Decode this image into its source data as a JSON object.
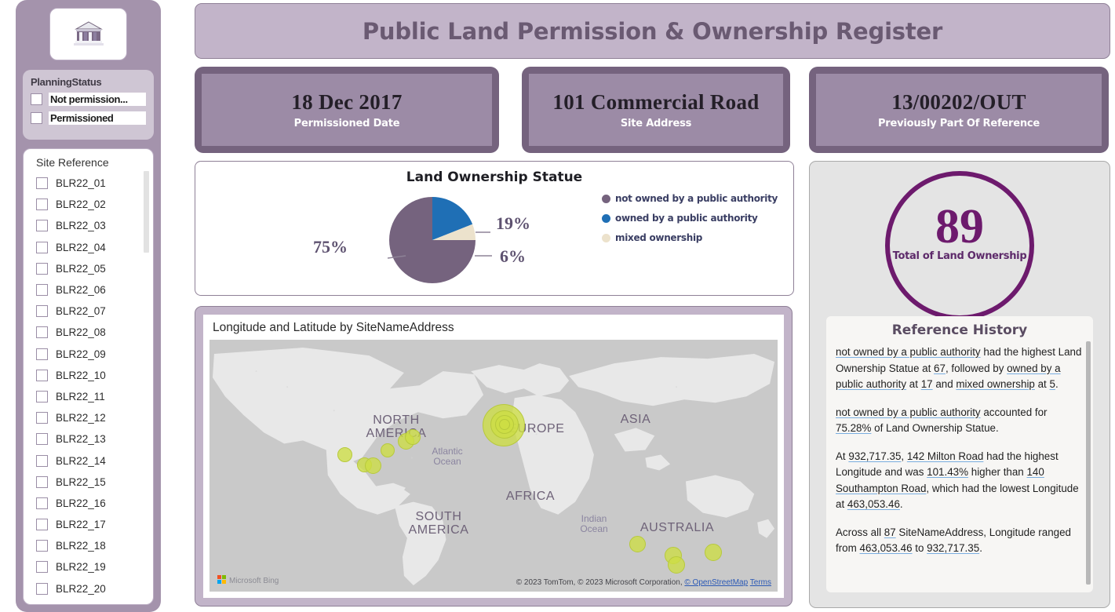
{
  "header": {
    "title": "Public Land Permission & Ownership Register"
  },
  "sidebar": {
    "brand_icon": "bank-building-icon",
    "status_filter": {
      "title": "PlanningStatus",
      "options": [
        {
          "label": "Not permission...",
          "checked": false
        },
        {
          "label": "Permissioned",
          "checked": false
        }
      ]
    },
    "site_reference": {
      "title": "Site Reference",
      "items": [
        {
          "label": "BLR22_01",
          "checked": false
        },
        {
          "label": "BLR22_02",
          "checked": false
        },
        {
          "label": "BLR22_03",
          "checked": false
        },
        {
          "label": "BLR22_04",
          "checked": false
        },
        {
          "label": "BLR22_05",
          "checked": false
        },
        {
          "label": "BLR22_06",
          "checked": false
        },
        {
          "label": "BLR22_07",
          "checked": false
        },
        {
          "label": "BLR22_08",
          "checked": false
        },
        {
          "label": "BLR22_09",
          "checked": false
        },
        {
          "label": "BLR22_10",
          "checked": false
        },
        {
          "label": "BLR22_11",
          "checked": false
        },
        {
          "label": "BLR22_12",
          "checked": false
        },
        {
          "label": "BLR22_13",
          "checked": false
        },
        {
          "label": "BLR22_14",
          "checked": false
        },
        {
          "label": "BLR22_15",
          "checked": false
        },
        {
          "label": "BLR22_16",
          "checked": false
        },
        {
          "label": "BLR22_17",
          "checked": false
        },
        {
          "label": "BLR22_18",
          "checked": false
        },
        {
          "label": "BLR22_19",
          "checked": false
        },
        {
          "label": "BLR22_20",
          "checked": false
        }
      ]
    }
  },
  "kpis": [
    {
      "value": "18 Dec 2017",
      "label": "Permissioned Date"
    },
    {
      "value": "101 Commercial Road",
      "label": "Site Address"
    },
    {
      "value": "13/00202/OUT",
      "label": "Previously Part Of Reference"
    }
  ],
  "chart_data": {
    "type": "pie",
    "title": "Land Ownership Statue",
    "categories": [
      "not owned by a public authority",
      "owned by a public authority",
      "mixed ownership"
    ],
    "values": [
      75,
      19,
      6
    ],
    "value_labels": [
      "75%",
      "19%",
      "6%"
    ],
    "counts": [
      67,
      17,
      5
    ],
    "colors": [
      "#75637e",
      "#1f6fb5",
      "#ece2cc"
    ],
    "legend_position": "right",
    "grid": false
  },
  "gauge": {
    "value": "89",
    "label": "Total of Land Ownership",
    "ring_color": "#6d1a6d"
  },
  "map": {
    "title": "Longitude and Latitude by SiteNameAddress",
    "provider": "Microsoft Bing",
    "attribution": "© 2023 TomTom, © 2023 Microsoft Corporation,",
    "attribution_link": "© OpenStreetMap",
    "terms": "Terms",
    "continent_labels": [
      "NORTH AMERICA",
      "EUROPE",
      "ASIA",
      "AFRICA",
      "SOUTH AMERICA",
      "AUSTRALIA"
    ],
    "ocean_labels": [
      "Atlantic Ocean",
      "Indian Ocean"
    ],
    "bubble_color": "#cdde44"
  },
  "history": {
    "title": "Reference History",
    "paragraphs": [
      {
        "parts": [
          {
            "t": "not owned by a public authority",
            "link": true
          },
          {
            "t": " had the highest Land Ownership Statue at ",
            "link": false
          },
          {
            "t": "67",
            "link": true
          },
          {
            "t": ", followed by ",
            "link": false
          },
          {
            "t": "owned by a public authority",
            "link": true
          },
          {
            "t": " at ",
            "link": false
          },
          {
            "t": "17",
            "link": true
          },
          {
            "t": " and ",
            "link": false
          },
          {
            "t": "mixed ownership",
            "link": true
          },
          {
            "t": " at ",
            "link": false
          },
          {
            "t": "5",
            "link": true
          },
          {
            "t": ".",
            "link": false
          }
        ]
      },
      {
        "parts": [
          {
            "t": "not owned by a public authority",
            "link": true
          },
          {
            "t": " accounted for ",
            "link": false
          },
          {
            "t": "75.28%",
            "link": true
          },
          {
            "t": " of Land Ownership Statue.",
            "link": false
          }
        ]
      },
      {
        "parts": [
          {
            "t": "At ",
            "link": false
          },
          {
            "t": "932,717.35",
            "link": true
          },
          {
            "t": ", ",
            "link": false
          },
          {
            "t": "142 Milton Road",
            "link": true
          },
          {
            "t": " had the highest Longitude and was ",
            "link": false
          },
          {
            "t": "101.43%",
            "link": true
          },
          {
            "t": " higher than ",
            "link": false
          },
          {
            "t": "140 Southampton Road",
            "link": true
          },
          {
            "t": ", which had the lowest Longitude at ",
            "link": false
          },
          {
            "t": "463,053.46",
            "link": true
          },
          {
            "t": ".",
            "link": false
          }
        ]
      },
      {
        "parts": [
          {
            "t": "Across all ",
            "link": false
          },
          {
            "t": "87",
            "link": true
          },
          {
            "t": " SiteNameAddress, Longitude ranged from ",
            "link": false
          },
          {
            "t": "463,053.46",
            "link": true
          },
          {
            "t": " to ",
            "link": false
          },
          {
            "t": "932,717.35",
            "link": true
          },
          {
            "t": ".",
            "link": false
          }
        ]
      }
    ]
  },
  "theme": {
    "mauve": "#a493ac",
    "deep_purple": "#75637e",
    "banner": "#c2b4c9",
    "accent_purple": "#6d1a6d",
    "blue": "#1f6fb5",
    "cream": "#ece2cc"
  }
}
